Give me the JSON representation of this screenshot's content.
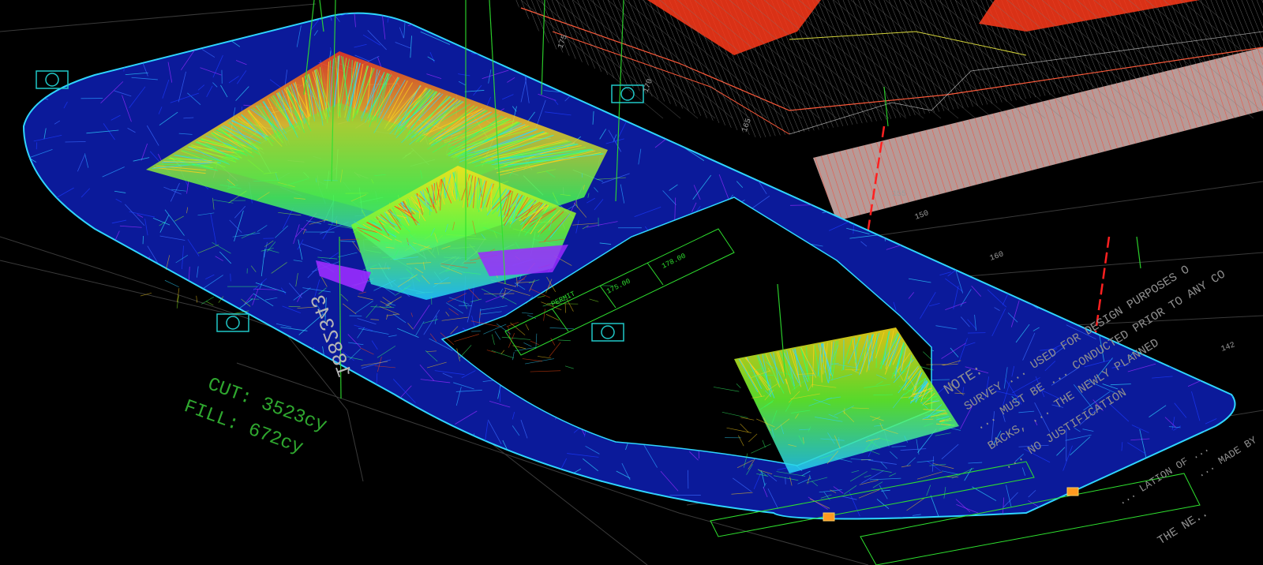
{
  "drawing": {
    "background": "#000000",
    "volume_label": {
      "cut": "CUT: 3523cy",
      "fill": "FILL: 672cy",
      "color": "#2fa82f"
    },
    "rotated_code": "1882343",
    "note_heading": "NOTE:",
    "note_lines": [
      "SURVEY ... USED FOR DESIGN PURPOSES O",
      "... MUST BE ... CONDUCTED PRIOR TO ANY CO",
      "BACKS, ... THE NEWLY PLANNED",
      "... NO JUSTIFICATION"
    ],
    "note_lower_lines": [
      "THE NE..",
      "... LATION OF ...",
      "... MADE BY"
    ],
    "note_color": "#8f8f8f",
    "contour_labels": [
      "175",
      "170",
      "165",
      "160",
      "155",
      "150",
      "142"
    ],
    "small_tags": [
      "PERMIT",
      "175.00",
      "178.00"
    ],
    "mesh_colors": {
      "outer": "#1d3bff",
      "edge": "#2fd5ff",
      "inner": "#35ff6a",
      "hot": "#ff4a12",
      "warm": "#ffd21a",
      "violet": "#9a2cff"
    },
    "road_color": "#ff3a24",
    "guide_color": "#2fe02f",
    "marker_color": "#20c8c8"
  }
}
